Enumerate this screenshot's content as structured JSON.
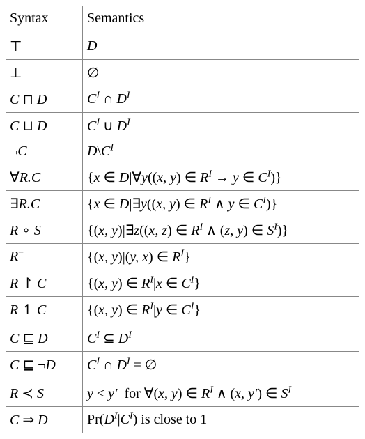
{
  "headers": {
    "syntax": "Syntax",
    "semantics": "Semantics"
  },
  "rows": [
    {
      "syntax": "<span class='up'>⊤</span>",
      "semantics": "<span class='cal'>D</span>"
    },
    {
      "syntax": "<span class='up'>⊥</span>",
      "semantics": "<span class='up'>∅</span>"
    },
    {
      "syntax": "C <span class='up'>⊓</span> D",
      "semantics": "C<sup class='supI'>I</sup> <span class='up'>∩</span> D<sup class='supI'>I</sup>"
    },
    {
      "syntax": "C <span class='up'>⊔</span> D",
      "semantics": "C<sup class='supI'>I</sup> <span class='up'>∪</span> D<sup class='supI'>I</sup>"
    },
    {
      "syntax": "<span class='up'>¬</span>C",
      "semantics": "<span class='cal'>D</span><span class='up'>\\</span>C<sup class='supI'>I</sup>"
    },
    {
      "syntax": "<span class='up'>∀</span>R.C",
      "semantics": "<span class='up'>{</span>x <span class='up'>∈</span> <span class='cal'>D</span><span class='up'>|∀</span>y<span class='up'>((</span>x, y<span class='up'>)</span> <span class='up'>∈</span> R<sup class='supI'>I</sup> <span class='up'>→</span> y <span class='up'>∈</span> C<sup class='supI'>I</sup><span class='up'>)}</span>"
    },
    {
      "syntax": "<span class='up'>∃</span>R.C",
      "semantics": "<span class='up'>{</span>x <span class='up'>∈</span> <span class='cal'>D</span><span class='up'>|∃</span>y<span class='up'>((</span>x, y<span class='up'>)</span> <span class='up'>∈</span> R<sup class='supI'>I</sup> <span class='up'>∧</span> y <span class='up'>∈</span> C<sup class='supI'>I</sup><span class='up'>)}</span>"
    },
    {
      "syntax": "R <span class='up'>∘</span> S",
      "semantics": "<span class='up'>{(</span>x, y<span class='up'>)|∃</span>z<span class='up'>((</span>x, z<span class='up'>)</span> <span class='up'>∈</span> R<sup class='supI'>I</sup> <span class='up'>∧</span> <span class='up'>(</span>z, y<span class='up'>)</span> <span class='up'>∈</span> S<sup class='supI'>I</sup><span class='up'>)}</span>"
    },
    {
      "syntax": "R<sup><span class='up'>−</span></sup>",
      "semantics": "<span class='up'>{(</span>x, y<span class='up'>)|(</span>y, x<span class='up'>)</span> <span class='up'>∈</span> R<sup class='supI'>I</sup><span class='up'>}</span>"
    },
    {
      "syntax": "R <span class='up'>↾</span> C",
      "semantics": "<span class='up'>{(</span>x, y<span class='up'>)</span> <span class='up'>∈</span> R<sup class='supI'>I</sup><span class='up'>|</span>x <span class='up'>∈</span> C<sup class='supI'>I</sup><span class='up'>}</span>"
    },
    {
      "syntax": "R <span class='up'>↿</span> C",
      "semantics": "<span class='up'>{(</span>x, y<span class='up'>)</span> <span class='up'>∈</span> R<sup class='supI'>I</sup><span class='up'>|</span>y <span class='up'>∈</span> C<sup class='supI'>I</sup><span class='up'>}</span>"
    }
  ],
  "section2": [
    {
      "syntax": "C <span class='up'>⊑</span> D",
      "semantics": "C<sup class='supI'>I</sup> <span class='up'>⊆</span> D<sup class='supI'>I</sup>"
    },
    {
      "syntax": "C <span class='up'>⊑</span> <span class='up'>¬</span>D",
      "semantics": "C<sup class='supI'>I</sup> <span class='up'>∩</span> D<sup class='supI'>I</sup> <span class='up'>= ∅</span>"
    }
  ],
  "section3": [
    {
      "syntax": "R <span class='up'>≺</span> S",
      "semantics": "y <span class='up'>&lt;</span> y′&nbsp; <span class='up'>for</span> <span class='up'>∀(</span>x, y<span class='up'>)</span> <span class='up'>∈</span> R<sup class='supI'>I</sup> <span class='up'>∧</span> <span class='up'>(</span>x, y′<span class='up'>)</span> <span class='up'>∈</span> S<sup class='supI'>I</sup>"
    },
    {
      "syntax": "C <span class='up'>⇒</span> D",
      "semantics": "<span class='up'>Pr(</span>D<sup class='supI'>I</sup><span class='up'>|</span>C<sup class='supI'>I</sup><span class='up'>)</span> <span class='up'>is close to 1</span>"
    }
  ]
}
